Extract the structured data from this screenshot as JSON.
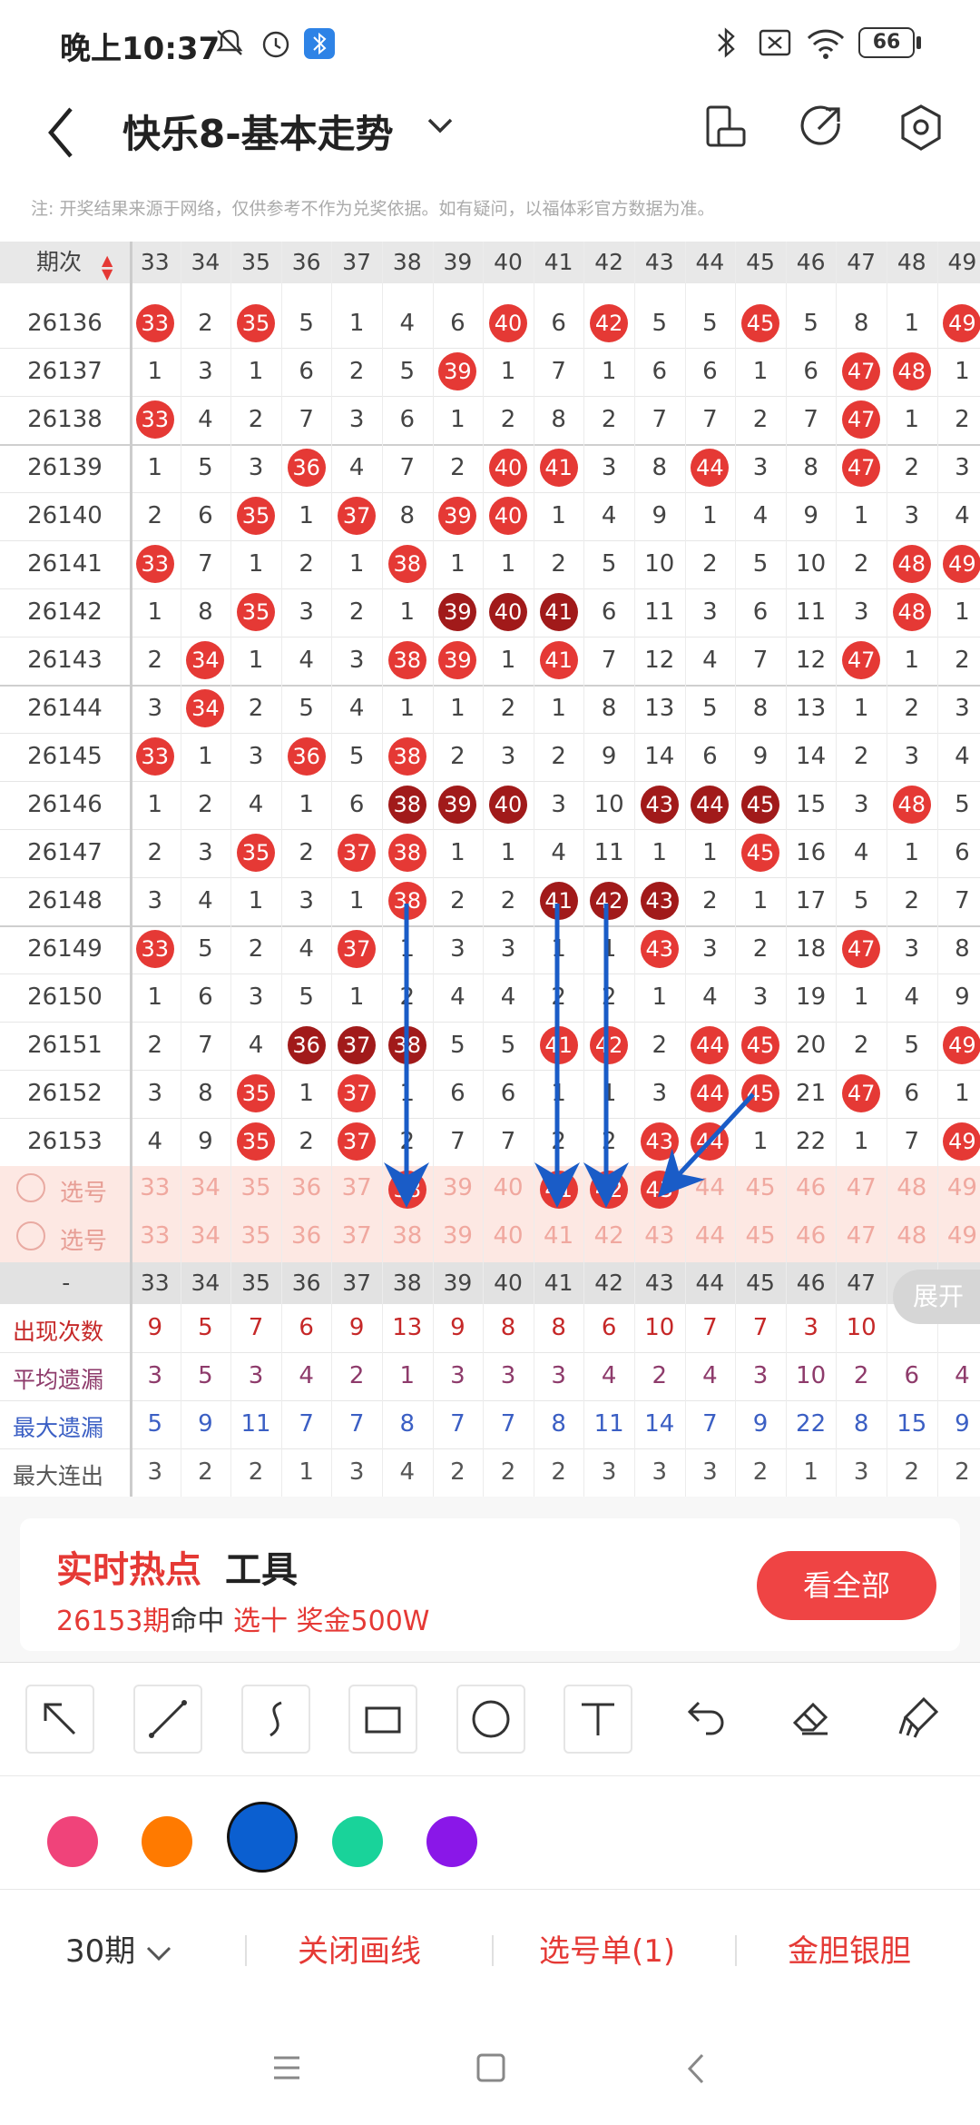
{
  "status": {
    "time": "晚上10:37",
    "battery": "66"
  },
  "header": {
    "title": "快乐8-基本走势"
  },
  "notice": "注: 开奖结果来源于网络，仅供参考不作为兑奖依据。如有疑问，以福体彩官方数据为准。",
  "table": {
    "phase_label": "期次",
    "columns": [
      "33",
      "34",
      "35",
      "36",
      "37",
      "38",
      "39",
      "40",
      "41",
      "42",
      "43",
      "44",
      "45",
      "46",
      "47",
      "48",
      "49"
    ],
    "rows": [
      {
        "phase": "26136",
        "cells": [
          "33",
          "2",
          "35",
          "5",
          "1",
          "4",
          "6",
          "40",
          "6",
          "42",
          "5",
          "5",
          "45",
          "5",
          "8",
          "1",
          "49"
        ]
      },
      {
        "phase": "26137",
        "cells": [
          "1",
          "3",
          "1",
          "6",
          "2",
          "5",
          "39",
          "1",
          "7",
          "1",
          "6",
          "6",
          "1",
          "6",
          "47",
          "48",
          "1"
        ]
      },
      {
        "phase": "26138",
        "cells": [
          "33",
          "4",
          "2",
          "7",
          "3",
          "6",
          "1",
          "2",
          "8",
          "2",
          "7",
          "7",
          "2",
          "7",
          "47",
          "1",
          "2"
        ]
      },
      {
        "phase": "26139",
        "cells": [
          "1",
          "5",
          "3",
          "36",
          "4",
          "7",
          "2",
          "40",
          "41",
          "3",
          "8",
          "44",
          "3",
          "8",
          "47",
          "2",
          "3"
        ]
      },
      {
        "phase": "26140",
        "cells": [
          "2",
          "6",
          "35",
          "1",
          "37",
          "8",
          "39",
          "40",
          "1",
          "4",
          "9",
          "1",
          "4",
          "9",
          "1",
          "3",
          "4"
        ]
      },
      {
        "phase": "26141",
        "cells": [
          "33",
          "7",
          "1",
          "2",
          "1",
          "38",
          "1",
          "1",
          "2",
          "5",
          "10",
          "2",
          "5",
          "10",
          "2",
          "48",
          "49"
        ]
      },
      {
        "phase": "26142",
        "cells": [
          "1",
          "8",
          "35",
          "3",
          "2",
          "1",
          "39",
          "40",
          "41",
          "6",
          "11",
          "3",
          "6",
          "11",
          "3",
          "48",
          "1"
        ]
      },
      {
        "phase": "26143",
        "cells": [
          "2",
          "34",
          "1",
          "4",
          "3",
          "38",
          "39",
          "1",
          "41",
          "7",
          "12",
          "4",
          "7",
          "12",
          "47",
          "1",
          "2"
        ]
      },
      {
        "phase": "26144",
        "cells": [
          "3",
          "34",
          "2",
          "5",
          "4",
          "1",
          "1",
          "2",
          "1",
          "8",
          "13",
          "5",
          "8",
          "13",
          "1",
          "2",
          "3"
        ]
      },
      {
        "phase": "26145",
        "cells": [
          "33",
          "1",
          "3",
          "36",
          "5",
          "38",
          "2",
          "3",
          "2",
          "9",
          "14",
          "6",
          "9",
          "14",
          "2",
          "3",
          "4"
        ]
      },
      {
        "phase": "26146",
        "cells": [
          "1",
          "2",
          "4",
          "1",
          "6",
          "38",
          "39",
          "40",
          "3",
          "10",
          "43",
          "44",
          "45",
          "15",
          "3",
          "48",
          "5"
        ]
      },
      {
        "phase": "26147",
        "cells": [
          "2",
          "3",
          "35",
          "2",
          "37",
          "38",
          "1",
          "1",
          "4",
          "11",
          "1",
          "1",
          "45",
          "16",
          "4",
          "1",
          "6"
        ]
      },
      {
        "phase": "26148",
        "cells": [
          "3",
          "4",
          "1",
          "3",
          "1",
          "38",
          "2",
          "2",
          "41",
          "42",
          "43",
          "2",
          "1",
          "17",
          "5",
          "2",
          "7"
        ]
      },
      {
        "phase": "26149",
        "cells": [
          "33",
          "5",
          "2",
          "4",
          "37",
          "1",
          "3",
          "3",
          "1",
          "1",
          "43",
          "3",
          "2",
          "18",
          "47",
          "3",
          "8"
        ]
      },
      {
        "phase": "26150",
        "cells": [
          "1",
          "6",
          "3",
          "5",
          "1",
          "2",
          "4",
          "4",
          "2",
          "2",
          "1",
          "4",
          "3",
          "19",
          "1",
          "4",
          "9"
        ]
      },
      {
        "phase": "26151",
        "cells": [
          "2",
          "7",
          "4",
          "36",
          "37",
          "38",
          "5",
          "5",
          "41",
          "42",
          "2",
          "44",
          "45",
          "20",
          "2",
          "5",
          "49"
        ]
      },
      {
        "phase": "26152",
        "cells": [
          "3",
          "8",
          "35",
          "1",
          "37",
          "1",
          "6",
          "6",
          "1",
          "1",
          "3",
          "44",
          "45",
          "21",
          "47",
          "6",
          "1"
        ]
      },
      {
        "phase": "26153",
        "cells": [
          "4",
          "9",
          "35",
          "2",
          "37",
          "2",
          "7",
          "7",
          "2",
          "2",
          "43",
          "44",
          "1",
          "22",
          "1",
          "7",
          "49"
        ]
      }
    ],
    "pick_label": "选号",
    "pick_rows": [
      {
        "selected": [
          "38",
          "41",
          "42",
          "43"
        ]
      },
      {
        "selected": []
      }
    ],
    "stats_header_label": "-",
    "stats": [
      {
        "label": "出现次数",
        "color": "#c62828",
        "values": [
          "9",
          "5",
          "7",
          "6",
          "9",
          "13",
          "9",
          "8",
          "8",
          "6",
          "10",
          "7",
          "7",
          "3",
          "10",
          "",
          ""
        ]
      },
      {
        "label": "平均遗漏",
        "color": "#8e3b6b",
        "values": [
          "3",
          "5",
          "3",
          "4",
          "2",
          "1",
          "3",
          "3",
          "3",
          "4",
          "2",
          "4",
          "3",
          "10",
          "2",
          "6",
          "4"
        ]
      },
      {
        "label": "最大遗漏",
        "color": "#3b5fc4",
        "values": [
          "5",
          "9",
          "11",
          "7",
          "7",
          "8",
          "7",
          "7",
          "8",
          "11",
          "14",
          "7",
          "9",
          "22",
          "8",
          "15",
          "9"
        ]
      },
      {
        "label": "最大连出",
        "color": "#555555",
        "values": [
          "3",
          "2",
          "2",
          "1",
          "3",
          "4",
          "2",
          "2",
          "2",
          "3",
          "3",
          "3",
          "2",
          "1",
          "3",
          "2",
          "2"
        ]
      }
    ],
    "expand_label": "展开"
  },
  "hot": {
    "title_red": "实时热点",
    "title_black": "工具",
    "sub_phase": "26153期",
    "sub_hit": "命中",
    "sub_rest": "选十 奖金500W",
    "button": "看全部"
  },
  "tools": [
    "arrow-tool",
    "line-tool",
    "curve-tool",
    "rect-tool",
    "circle-tool",
    "text-tool",
    "undo-tool",
    "eraser-tool",
    "clear-tool"
  ],
  "colors": [
    "#f0437a",
    "#ff7a00",
    "#0b5fd0",
    "#19d39a",
    "#8a17e8"
  ],
  "bottom": {
    "period": "30期",
    "close_draw": "关闭画线",
    "pick_list": "选号单(1)",
    "gold": "金胆银胆"
  }
}
